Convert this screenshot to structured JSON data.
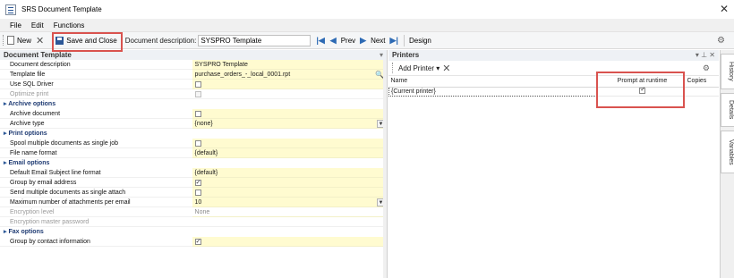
{
  "window": {
    "title": "SRS Document Template",
    "close_icon": "✕"
  },
  "menu": [
    "File",
    "Edit",
    "Functions"
  ],
  "toolbar": {
    "new_label": "New",
    "save_label": "Save and Close",
    "desc_label": "Document description:",
    "desc_value": "SYSPRO Template",
    "prev_label": "Prev",
    "next_label": "Next",
    "design_label": "Design"
  },
  "left_panel": {
    "title": "Document Template",
    "rows": [
      {
        "label": "Document description",
        "value": "SYSPRO Template"
      },
      {
        "label": "Template file",
        "value": "purchase_orders_-_local_0001.rpt"
      },
      {
        "label": "Use SQL Driver"
      },
      {
        "label": "Optimize print"
      },
      {
        "section": "Archive options"
      },
      {
        "label": "Archive document"
      },
      {
        "label": "Archive type",
        "value": "{none}"
      },
      {
        "section": "Print options"
      },
      {
        "label": "Spool multiple documents as single job"
      },
      {
        "label": "File name format",
        "value": "{default}"
      },
      {
        "section": "Email options"
      },
      {
        "label": "Default Email Subject line format",
        "value": "{default}"
      },
      {
        "label": "Group by email address"
      },
      {
        "label": "Send multiple documents as single attach"
      },
      {
        "label": "Maximum number of attachments per email",
        "value": "10"
      },
      {
        "label": "Encryption level",
        "value": "None"
      },
      {
        "label": "Encryption master password"
      },
      {
        "section": "Fax options"
      },
      {
        "label": "Group by contact information"
      }
    ]
  },
  "right_panel": {
    "title": "Printers",
    "add_printer_label": "Add Printer",
    "columns": [
      "Name",
      "Prompt at runtime",
      "Copies"
    ],
    "rows": [
      {
        "name": "{Current printer}",
        "prompt": true,
        "copies": ""
      }
    ]
  },
  "side_tabs": [
    "History",
    "Details",
    "Variables"
  ]
}
